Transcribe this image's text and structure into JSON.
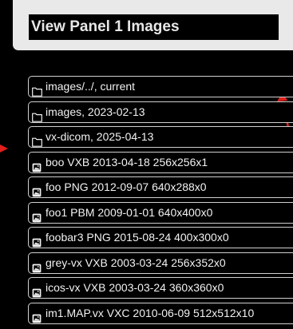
{
  "header": {
    "title": "View Panel 1 Images"
  },
  "list": {
    "items": [
      {
        "label": "images/../, current",
        "icon": "folder-icon"
      },
      {
        "label": "images, 2023-02-13",
        "icon": "folder-icon"
      },
      {
        "label": "vx-dicom, 2025-04-13",
        "icon": "folder-icon"
      },
      {
        "label": "boo VXB 2013-04-18 256x256x1",
        "icon": "image-file-icon"
      },
      {
        "label": "foo PNG 2012-09-07 640x288x0",
        "icon": "image-file-icon"
      },
      {
        "label": "foo1 PBM 2009-01-01 640x400x0",
        "icon": "image-file-icon"
      },
      {
        "label": "foobar3 PNG 2015-08-24 400x300x0",
        "icon": "image-file-icon"
      },
      {
        "label": "grey-vx VXB 2003-03-24 256x352x0",
        "icon": "image-file-icon"
      },
      {
        "label": "icos-vx VXB 2003-03-24 360x360x0",
        "icon": "image-file-icon"
      },
      {
        "label": "im1.MAP.vx VXC 2010-06-09 512x512x10",
        "icon": "image-file-icon"
      }
    ]
  },
  "colors": {
    "background": "#000000",
    "header": "#e9e9e9",
    "item_border": "#cfcfcf",
    "text": "#f2f2f2",
    "annotation": "#e0201c"
  }
}
